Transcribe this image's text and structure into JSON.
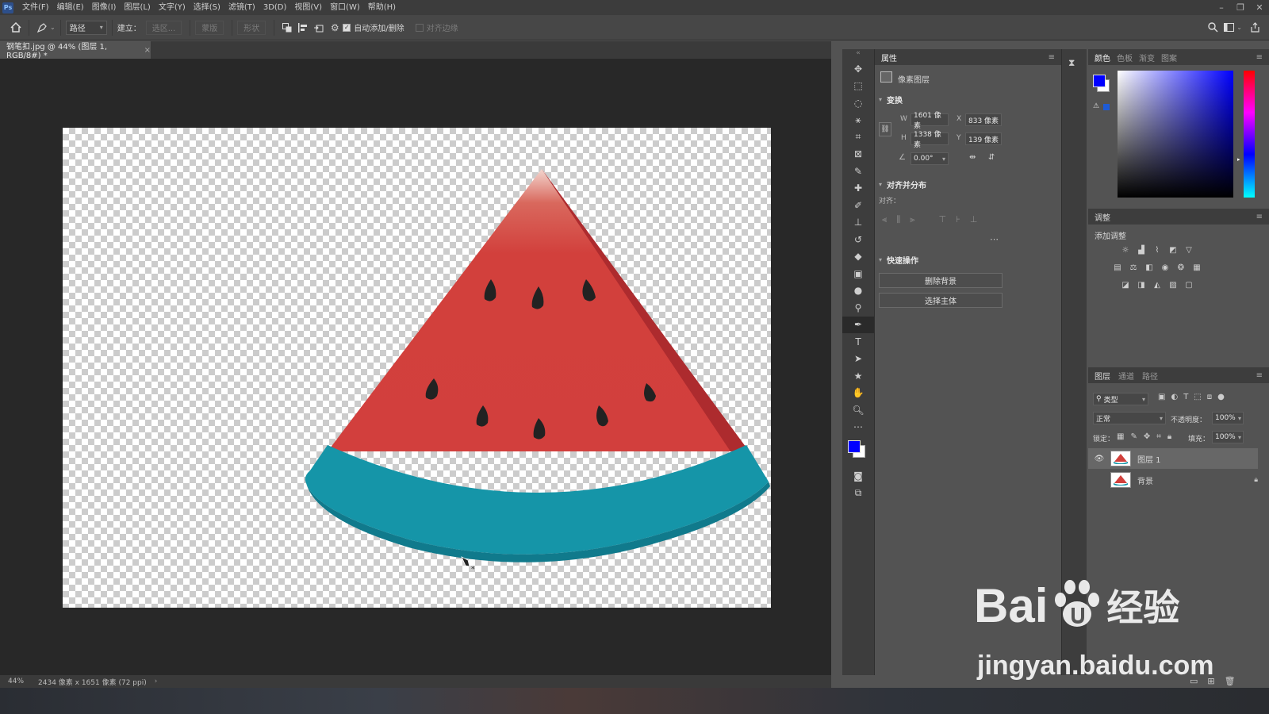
{
  "menubar": {
    "items": [
      "文件(F)",
      "编辑(E)",
      "图像(I)",
      "图层(L)",
      "文字(Y)",
      "选择(S)",
      "滤镜(T)",
      "3D(D)",
      "视图(V)",
      "窗口(W)",
      "帮助(H)"
    ],
    "app_icon": "Ps"
  },
  "options": {
    "mode": "路径",
    "make_label": "建立：",
    "selection_btn": "选区...",
    "mask_btn": "蒙版",
    "shape_btn": "形状",
    "auto_add_label": "自动添加/删除",
    "auto_add_checked": true,
    "align_edges_label": "对齐边缘",
    "align_edges_checked": false
  },
  "document": {
    "tab_title": "钢笔扣.jpg @ 44% (图层 1, RGB/8#) *",
    "zoom": "44%",
    "doc_info": "2434 像素 x 1651 像素 (72 ppi)"
  },
  "properties": {
    "tab": "属性",
    "layer_type": "像素图层",
    "transform_title": "变换",
    "w_label": "W",
    "w": "1601 像素",
    "h_label": "H",
    "h": "1338 像素",
    "x_label": "X",
    "x": "833 像素",
    "y_label": "Y",
    "y": "139 像素",
    "angle": "0.00°",
    "align_title": "对齐并分布",
    "align_label": "对齐：",
    "quick_title": "快速操作",
    "remove_bg": "删除背景",
    "select_subject": "选择主体"
  },
  "color_panel": {
    "tabs": [
      "颜色",
      "色板",
      "渐变",
      "图案"
    ],
    "foreground": "#0000ff",
    "background": "#ffffff"
  },
  "adjust_panel": {
    "tab": "调整",
    "add_label": "添加调整"
  },
  "layers_panel": {
    "tabs": [
      "图层",
      "通道",
      "路径"
    ],
    "filter_kind": "类型",
    "blend_mode": "正常",
    "opacity_label": "不透明度：",
    "opacity": "100%",
    "lock_label": "锁定：",
    "fill_label": "填充：",
    "fill": "100%",
    "layers": [
      {
        "name": "图层 1",
        "visible": true,
        "selected": true
      },
      {
        "name": "背景",
        "visible": false,
        "locked": true
      }
    ]
  },
  "watermark": {
    "brand_latin": "Bai",
    "brand_cn": "经验",
    "url": "jingyan.baidu.com"
  }
}
